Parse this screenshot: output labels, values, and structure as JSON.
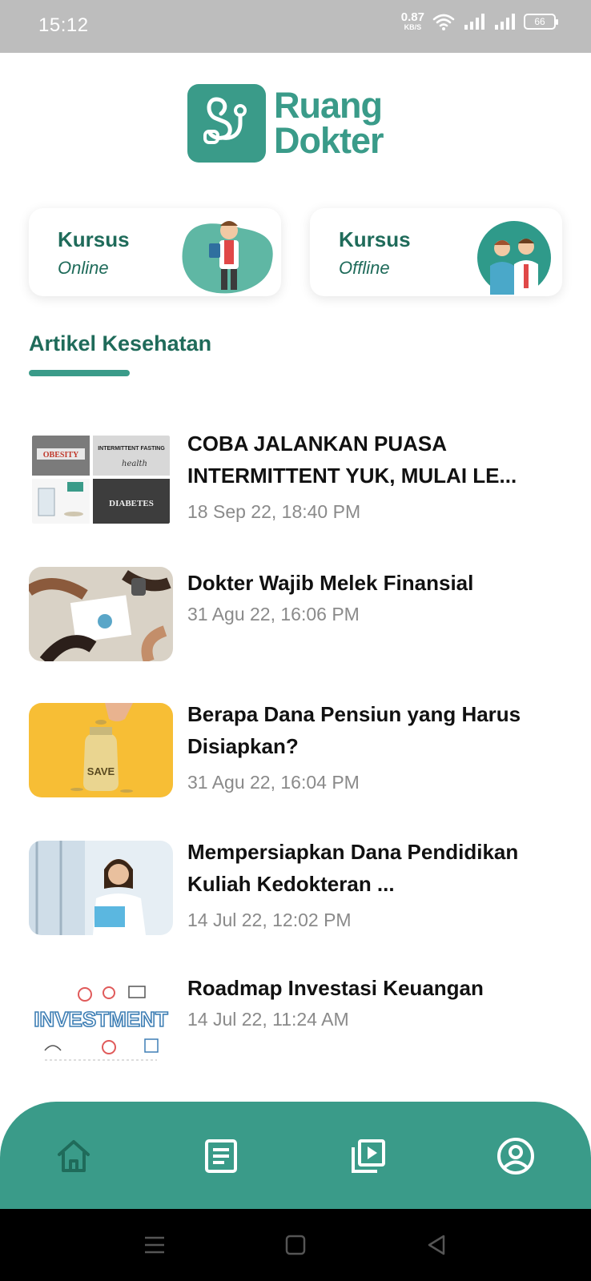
{
  "status_bar": {
    "time": "15:12",
    "net_speed_value": "0.87",
    "net_speed_unit": "KB/S",
    "battery": "66"
  },
  "brand": {
    "line1": "Ruang",
    "line2": "Dokter",
    "accent_color": "#3a9b89",
    "dark_color": "#1f6b5a"
  },
  "courses": [
    {
      "title": "Kursus",
      "subtitle": "Online",
      "illustration": "doctor-with-clipboard"
    },
    {
      "title": "Kursus",
      "subtitle": "Offline",
      "illustration": "two-doctors"
    }
  ],
  "section": {
    "title": "Artikel Kesehatan"
  },
  "articles": [
    {
      "title": "COBA JALANKAN PUASA INTERMITTENT YUK, MULAI LE...",
      "date": "18 Sep 22, 18:40 PM",
      "thumb": "obesity-diabetes-collage"
    },
    {
      "title": "Dokter Wajib Melek Finansial",
      "date": "31 Agu 22, 16:06 PM",
      "thumb": "business-meeting"
    },
    {
      "title": "Berapa Dana Pensiun yang Harus Disiapkan?",
      "date": "31 Agu 22, 16:04 PM",
      "thumb": "save-jar"
    },
    {
      "title": "Mempersiapkan Dana Pendidikan Kuliah Kedokteran ...",
      "date": "14 Jul 22, 12:02 PM",
      "thumb": "female-doctor"
    },
    {
      "title": "Roadmap Investasi Keuangan",
      "date": "14 Jul 22, 11:24 AM",
      "thumb": "investment-doodle"
    }
  ],
  "bottom_nav": [
    {
      "icon": "home-icon",
      "active": true
    },
    {
      "icon": "article-icon",
      "active": false
    },
    {
      "icon": "video-library-icon",
      "active": false
    },
    {
      "icon": "profile-icon",
      "active": false
    }
  ],
  "thumb_texts": {
    "obesity": "OBESITY",
    "fasting": "INTERMITTENT FASTING",
    "health": "health",
    "diabetes": "DIABETES",
    "save": "SAVE",
    "investment": "INVESTMENT"
  }
}
